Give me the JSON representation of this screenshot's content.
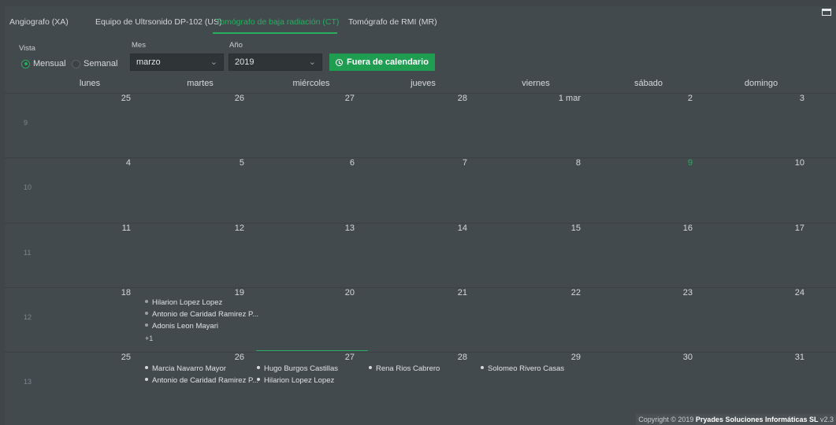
{
  "tabs": [
    {
      "label": "Angiografo (XA)"
    },
    {
      "label": "Equipo de Ultrsonido DP-102 (US)"
    },
    {
      "label": "Tomógrafo de baja radiación (CT)"
    },
    {
      "label": "Tomógrafo de RMI (MR)"
    }
  ],
  "controls": {
    "vista_label": "Vista",
    "mes_label": "Mes",
    "anio_label": "Año",
    "mensual": "Mensual",
    "semanal": "Semanal",
    "mes_value": "marzo",
    "anio_value": "2019",
    "fuera_button": "Fuera de calendario"
  },
  "weekdays": [
    "lunes",
    "martes",
    "miércoles",
    "jueves",
    "viernes",
    "sábado",
    "domingo"
  ],
  "weeks": [
    {
      "num": "9",
      "days": [
        "25",
        "26",
        "27",
        "28",
        "1 mar",
        "2",
        "3"
      ]
    },
    {
      "num": "10",
      "days": [
        "4",
        "5",
        "6",
        "7",
        "8",
        "9",
        "10"
      ]
    },
    {
      "num": "11",
      "days": [
        "11",
        "12",
        "13",
        "14",
        "15",
        "16",
        "17"
      ]
    },
    {
      "num": "12",
      "days": [
        "18",
        "19",
        "20",
        "21",
        "22",
        "23",
        "24"
      ]
    },
    {
      "num": "13",
      "days": [
        "25",
        "26",
        "27",
        "28",
        "29",
        "30",
        "31"
      ]
    }
  ],
  "events": {
    "w12_mon": [
      "Hilarion Lopez Lopez",
      "Antonio de Caridad Ramirez P...",
      "Adonis Leon Mayari"
    ],
    "w12_more": "+1",
    "w13_mon": [
      "Marcia Navarro Mayor",
      "Antonio de Caridad Ramirez P..."
    ],
    "w13_tue": [
      "Hugo Burgos Castillas",
      "Hilarion Lopez Lopez"
    ],
    "w13_wed": [
      "Rena Rios Cabrero"
    ],
    "w13_thu": [
      "Solomeo Rivero Casas"
    ]
  },
  "footer": {
    "prefix": "Copyright © 2019 ",
    "company": "Pryades Soluciones Informáticas SL",
    "version": " v2.3"
  }
}
